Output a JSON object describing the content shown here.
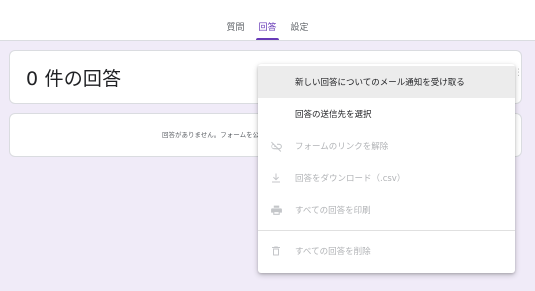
{
  "tabs": [
    {
      "label": "質問"
    },
    {
      "label": "回答"
    },
    {
      "label": "設定"
    }
  ],
  "summary": {
    "title": "0 件の回答"
  },
  "empty_state": {
    "text": "回答がありません。フォームを公開して回答の受付を開始しましょう。"
  },
  "menu": {
    "items": [
      {
        "label": "新しい回答についてのメール通知を受け取る",
        "icon": "none"
      },
      {
        "label": "回答の送信先を選択",
        "icon": "none"
      },
      {
        "label": "フォームのリンクを解除",
        "icon": "link-off-icon"
      },
      {
        "label": "回答をダウンロード（.csv）",
        "icon": "download-icon"
      },
      {
        "label": "すべての回答を印刷",
        "icon": "print-icon"
      },
      {
        "label": "すべての回答を削除",
        "icon": "trash-icon"
      }
    ]
  },
  "colors": {
    "accent": "#673ab7",
    "background": "#f0ebf8"
  }
}
